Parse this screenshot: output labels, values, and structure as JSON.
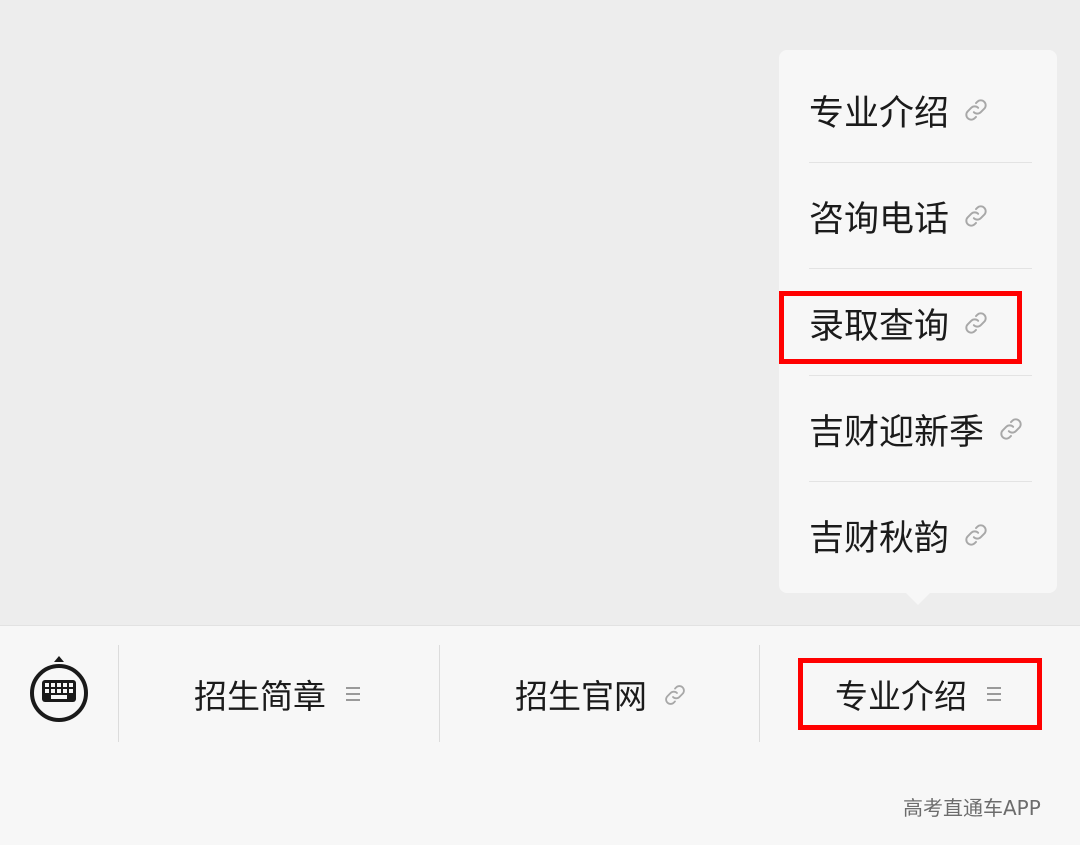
{
  "submenu": {
    "items": [
      {
        "label": "专业介绍",
        "icon": "link-icon"
      },
      {
        "label": "咨询电话",
        "icon": "link-icon"
      },
      {
        "label": "录取查询",
        "icon": "link-icon"
      },
      {
        "label": "吉财迎新季",
        "icon": "link-icon"
      },
      {
        "label": "吉财秋韵",
        "icon": "link-icon"
      }
    ]
  },
  "menu_bar": {
    "keyboard_icon": "keyboard-icon",
    "buttons": [
      {
        "label": "招生简章",
        "icon": "menu-lines-icon"
      },
      {
        "label": "招生官网",
        "icon": "link-icon"
      },
      {
        "label": "专业介绍",
        "icon": "menu-lines-icon"
      }
    ]
  },
  "annotations": {
    "highlight_color": "#ff0000"
  },
  "watermark": {
    "text": "高考直通车APP"
  }
}
